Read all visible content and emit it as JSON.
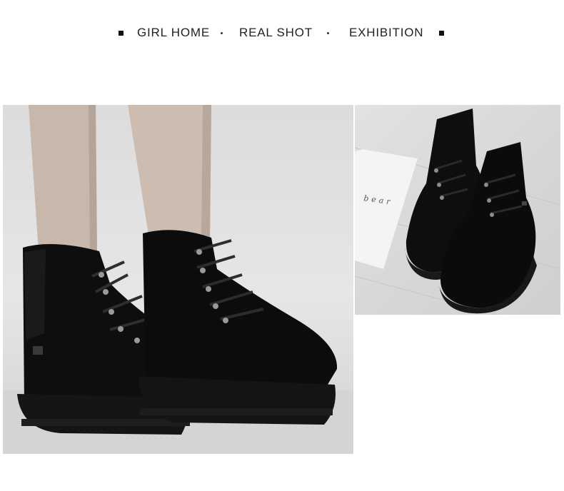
{
  "header": {
    "items": [
      "GIRL HOME",
      "REAL SHOT",
      "EXHIBITION"
    ]
  },
  "photos": {
    "main_alt": "legs wearing black suede lace-up ankle boots",
    "side_alt": "pair of black suede lace-up boots on floor beside card",
    "side_card_text": "bear"
  },
  "colors": {
    "boot": "#0d0d0d",
    "sole": "#161616",
    "lace": "#2a2a2a",
    "eyelet": "#9a9a9a",
    "skin": "#c9b9ac",
    "background": "#e0e0e0"
  }
}
